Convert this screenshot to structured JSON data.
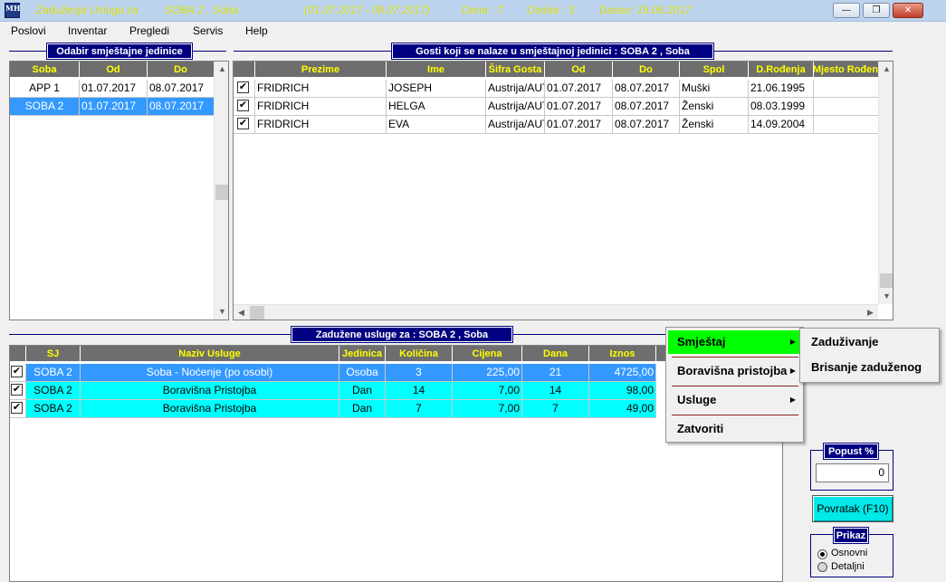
{
  "title": {
    "app": "Zaduženja Usluga za",
    "room": "SOBA 2 , Soba",
    "period": "(01.07.2017 - 08.07.2017)",
    "days": "Dana : 7",
    "persons": "Osoba : 3",
    "today": "Danas: 19.06.2017",
    "icon": "MH"
  },
  "window_buttons": {
    "minimize": "—",
    "maximize": "❐",
    "close": "✕"
  },
  "menu": [
    "Poslovi",
    "Inventar",
    "Pregledi",
    "Servis",
    "Help"
  ],
  "units": {
    "label": "Odabir smještajne jedinice",
    "columns": [
      "Soba",
      "Od",
      "Do"
    ],
    "rows": [
      [
        "APP 1",
        "01.07.2017",
        "08.07.2017"
      ],
      [
        "SOBA 2",
        "01.07.2017",
        "08.07.2017"
      ]
    ]
  },
  "guests": {
    "label": "Gosti koji se nalaze u smještajnoj jedinici : SOBA 2 , Soba",
    "columns": [
      "Prezime",
      "Ime",
      "Šifra Gosta",
      "Od",
      "Do",
      "Spol",
      "D.Rođenja",
      "Mjesto Rođen"
    ],
    "rows": [
      [
        "FRIDRICH",
        "JOSEPH",
        "Austrija/AUT",
        "01.07.2017",
        "08.07.2017",
        "Muški",
        "21.06.1995",
        ""
      ],
      [
        "FRIDRICH",
        "HELGA",
        "Austrija/AUT",
        "01.07.2017",
        "08.07.2017",
        "Ženski",
        "08.03.1999",
        ""
      ],
      [
        "FRIDRICH",
        "EVA",
        "Austrija/AUT",
        "01.07.2017",
        "08.07.2017",
        "Ženski",
        "14.09.2004",
        ""
      ]
    ]
  },
  "services": {
    "label": "Zadužene usluge za : SOBA 2 , Soba",
    "columns": [
      "SJ",
      "Naziv Usluge",
      "Jedinica",
      "Količina",
      "Cijena",
      "Dana",
      "Iznos"
    ],
    "rows": [
      [
        "SOBA 2",
        "Soba - Noćenje (po osobi)",
        "Osoba",
        "3",
        "225,00",
        "21",
        "4725,00"
      ],
      [
        "SOBA 2",
        "Boravišna Pristojba",
        "Dan",
        "14",
        "7,00",
        "14",
        "98,00"
      ],
      [
        "SOBA 2",
        "Boravišna Pristojba",
        "Dan",
        "7",
        "7,00",
        "7",
        "49,00"
      ]
    ]
  },
  "context_menu": {
    "items": [
      "Smještaj",
      "Boravišna pristojba",
      "Usluge",
      "Zatvoriti"
    ],
    "submenu": [
      "Zaduživanje",
      "Brisanje zaduženog"
    ]
  },
  "discount": {
    "label": "Popust %",
    "value": "0"
  },
  "back_button": "Povratak (F10)",
  "view": {
    "label": "Prikaz",
    "options": [
      "Osnovni",
      "Detaljni"
    ],
    "selected": "Osnovni"
  },
  "colors": {
    "header_bg": "#6e6e6e",
    "header_text": "#ffff00",
    "selection": "#3399ff",
    "cyan_row": "#00ffff",
    "menu_highlight": "#00ff00",
    "group_label": "#000080"
  },
  "icons": {
    "check": "✔",
    "arrow_up": "▲",
    "arrow_down": "▼",
    "arrow_left": "◀",
    "arrow_right": "▶",
    "submenu_arrow": "▶"
  }
}
